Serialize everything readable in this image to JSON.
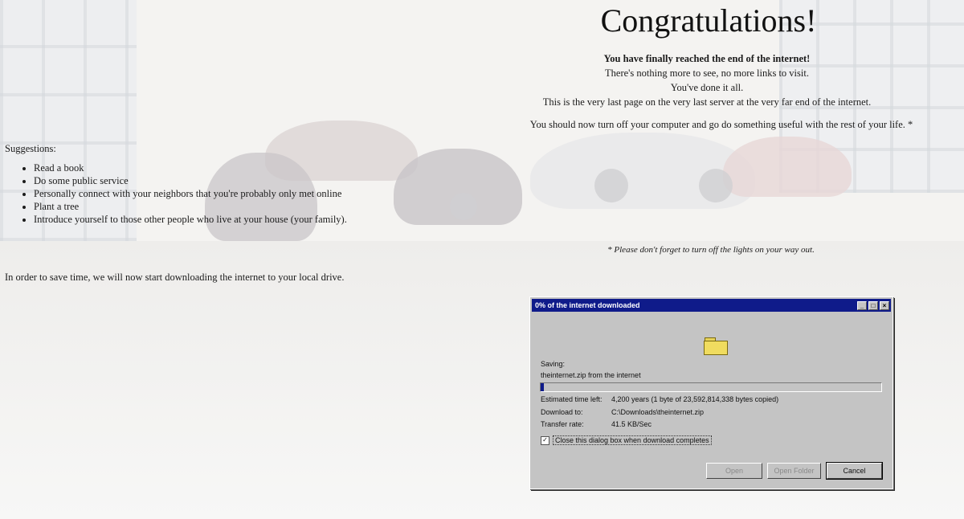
{
  "heading": {
    "title": "Congratulations!",
    "lines": [
      "You have finally reached the end of the internet!",
      "There's nothing more to see, no more links to visit.",
      "You've done it all.",
      "This is the very last page on the very last server at the very far end of the internet."
    ],
    "final": "You should now turn off your computer and go do something useful with the rest of your life. *"
  },
  "suggestions": {
    "label": "Suggestions:",
    "items": [
      "Read a book",
      "Do some public service",
      "Personally connect with your neighbors that you're probably only met online",
      "Plant a tree",
      "Introduce yourself to those other people who live at your house (your family)."
    ]
  },
  "note": "* Please don't forget to turn off the lights on your way out.",
  "download_text": "In order to save time, we will now start downloading the internet to your local drive.",
  "dialog": {
    "title": "0% of the internet downloaded",
    "saving_label": "Saving:",
    "saving_value": "theinternet.zip from the internet",
    "progress_fraction": 0.01,
    "rows": [
      {
        "key": "Estimated time left:",
        "value": "4,200 years (1 byte of 23,592,814,338 bytes copied)"
      },
      {
        "key": "Download to:",
        "value": "C:\\Downloads\\theinternet.zip"
      },
      {
        "key": "Transfer rate:",
        "value": "41.5 KB/Sec"
      }
    ],
    "checkbox_label": "Close this dialog box when download completes",
    "checkbox_checked": true,
    "buttons": {
      "open": "Open",
      "open_folder": "Open Folder",
      "cancel": "Cancel"
    }
  }
}
